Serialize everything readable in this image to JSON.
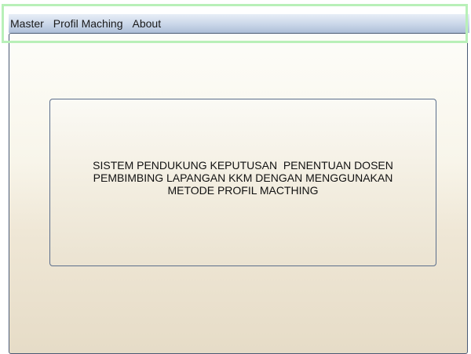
{
  "menu": {
    "items": [
      {
        "label": "Master"
      },
      {
        "label": "Profil Maching"
      },
      {
        "label": "About"
      }
    ]
  },
  "main": {
    "title_lines": [
      "SISTEM PENDUKUNG KEPUTUSAN  PENENTUAN DOSEN",
      "PEMBIMBING LAPANGAN KKM DENGAN MENGGUNAKAN",
      "METODE PROFIL MACTHING"
    ]
  },
  "colors": {
    "menubar_bottom": "#aebfd8",
    "client_border": "#4a5a75",
    "highlight": "#b8f0b8"
  }
}
